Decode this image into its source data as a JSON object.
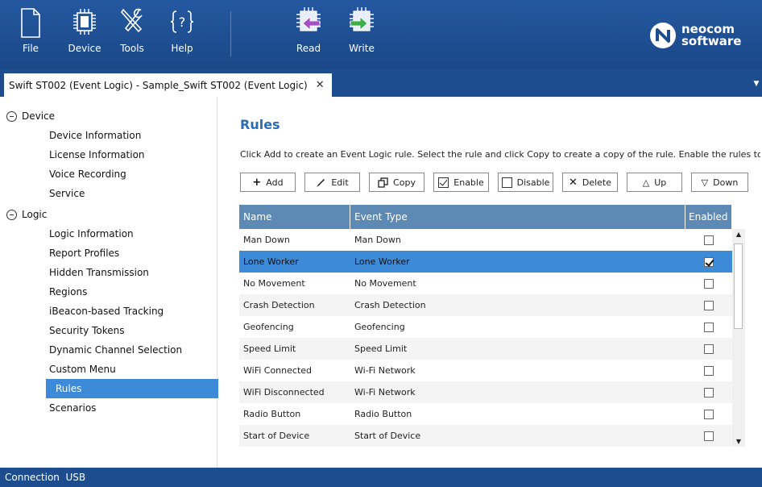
{
  "toolbar": {
    "file": "File",
    "device": "Device",
    "tools": "Tools",
    "help": "Help",
    "read": "Read",
    "write": "Write",
    "logo_line1": "neocom",
    "logo_line2": "software"
  },
  "tab": {
    "title": "Swift ST002 (Event Logic) - Sample_Swift ST002 (Event Logic)",
    "close": "✕",
    "menu": "▼"
  },
  "sidebar": {
    "device_group": "Device",
    "device_items": [
      "Device Information",
      "License Information",
      "Voice Recording",
      "Service"
    ],
    "logic_group": "Logic",
    "logic_items": [
      "Logic Information",
      "Report Profiles",
      "Hidden Transmission",
      "Regions",
      "iBeacon-based Tracking",
      "Security Tokens",
      "Dynamic Channel Selection",
      "Custom Menu",
      "Rules",
      "Scenarios"
    ],
    "selected": "Rules"
  },
  "main": {
    "title": "Rules",
    "hint": "Click Add to create an Event Logic rule. Select the rule and click Copy to create a copy of the rule. Enable the rules to...",
    "buttons": {
      "add": "Add",
      "edit": "Edit",
      "copy": "Copy",
      "enable": "Enable",
      "disable": "Disable",
      "delete": "Delete",
      "up": "Up",
      "down": "Down"
    }
  },
  "grid": {
    "columns": [
      "Name",
      "Event Type",
      "Enabled"
    ],
    "rows": [
      {
        "name": "Man Down",
        "event": "Man Down",
        "enabled": false
      },
      {
        "name": "Lone Worker",
        "event": "Lone Worker",
        "enabled": true,
        "selected": true
      },
      {
        "name": "No Movement",
        "event": "No Movement",
        "enabled": false
      },
      {
        "name": "Crash Detection",
        "event": "Crash Detection",
        "enabled": false
      },
      {
        "name": "Geofencing",
        "event": "Geofencing",
        "enabled": false
      },
      {
        "name": "Speed Limit",
        "event": "Speed Limit",
        "enabled": false
      },
      {
        "name": "WiFi Connected",
        "event": "Wi-Fi Network",
        "enabled": false
      },
      {
        "name": "WiFi Disconnected",
        "event": "Wi-Fi Network",
        "enabled": false
      },
      {
        "name": "Radio Button",
        "event": "Radio Button",
        "enabled": false
      },
      {
        "name": "Start of Device",
        "event": "Start of Device",
        "enabled": false
      }
    ]
  },
  "status": {
    "text": "Connection  USB"
  },
  "colors": {
    "chrome": "#1e4d8f",
    "accent": "#3d8ad9",
    "header": "#5d8ab5",
    "title": "#2a6cb7"
  }
}
